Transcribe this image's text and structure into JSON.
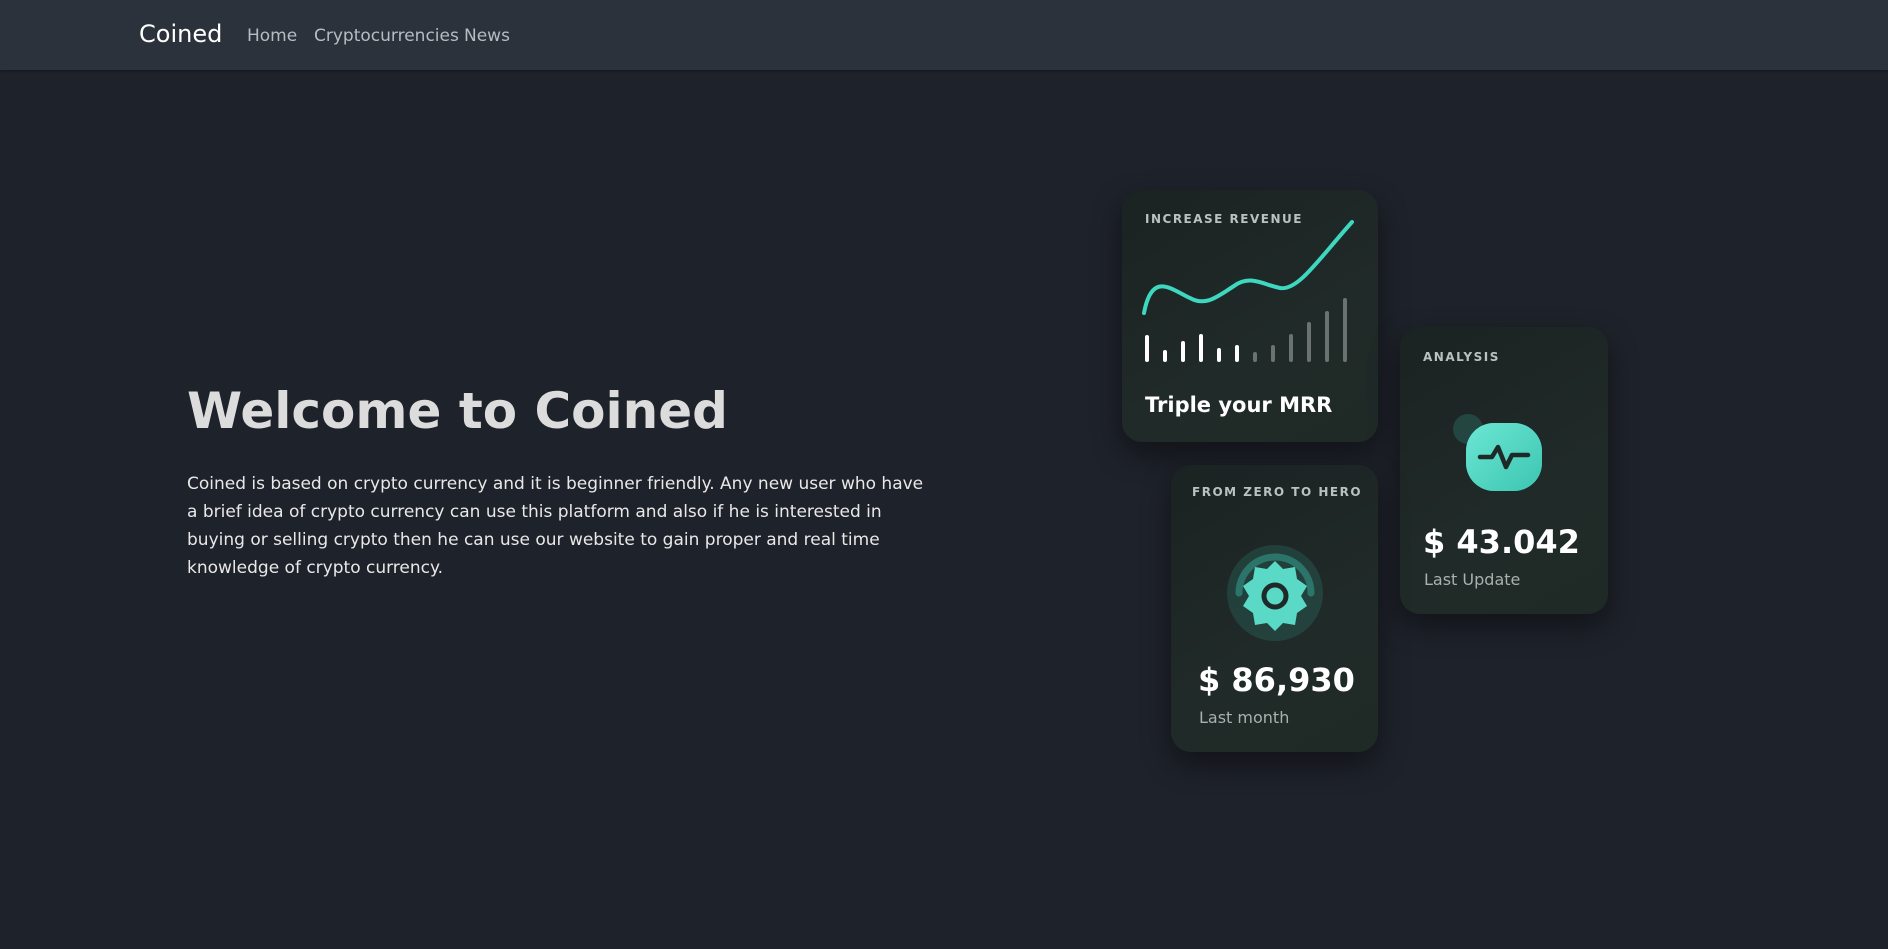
{
  "navbar": {
    "brand": "Coined",
    "links": [
      "Home",
      "Cryptocurrencies",
      "News"
    ]
  },
  "hero": {
    "title": "Welcome to Coined",
    "description": "Coined is based on crypto currency and it is beginner friendly. Any new user who have a brief idea of crypto currency can use this platform and also if he is interested in buying or selling crypto then he can use our website to gain proper and real time knowledge of crypto currency."
  },
  "cards": {
    "revenue": {
      "label": "INCREASE REVENUE",
      "headline": "Triple your MRR"
    },
    "analysis": {
      "label": "ANALYSIS",
      "value": "$ 43.042",
      "sub": "Last Update",
      "icon": "pulse-icon"
    },
    "hero": {
      "label": "FROM ZERO TO HERO",
      "value": "$ 86,930",
      "sub": "Last month",
      "icon": "gear-icon"
    }
  },
  "colors": {
    "background": "#1e222a",
    "navbar": "#2c323b",
    "accent": "#3ed8c0",
    "card": "#1f2826"
  }
}
